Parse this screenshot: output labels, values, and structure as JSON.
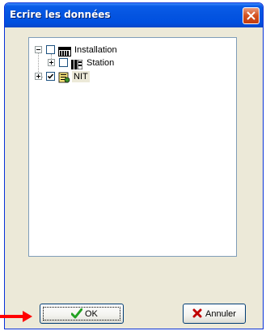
{
  "window": {
    "title": "Ecrire les données",
    "close_icon": "close-x-icon"
  },
  "tree": {
    "nodes": [
      {
        "label": "Installation",
        "checked": false,
        "expanded": true,
        "icon": "installation-rack-icon"
      },
      {
        "label": "Station",
        "checked": false,
        "expanded": false,
        "icon": "station-icon"
      },
      {
        "label": "NIT",
        "checked": true,
        "expanded": false,
        "icon": "nit-document-icon",
        "selected": true
      }
    ]
  },
  "buttons": {
    "ok_label": "OK",
    "ok_icon": "checkmark-icon",
    "cancel_label": "Annuler",
    "cancel_icon": "red-x-icon"
  },
  "annotation": {
    "arrow_icon": "red-arrow-right-icon",
    "arrow_color": "#ff0000"
  },
  "colors": {
    "titlebar": "#0454e0",
    "dialog_bg": "#ece9d8",
    "close_button": "#d4501f",
    "check_green": "#21a121",
    "cancel_red": "#c00000"
  }
}
